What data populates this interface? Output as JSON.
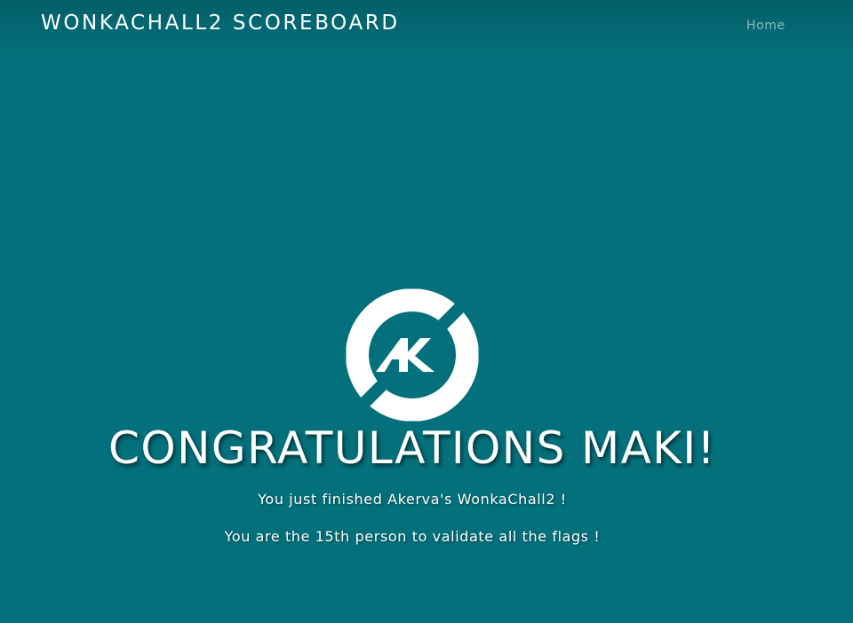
{
  "navbar": {
    "brand": "WONKACHALL2 SCOREBOARD",
    "home_link": "Home"
  },
  "logo": {
    "name": "akerva-logo",
    "letters": "AK"
  },
  "main": {
    "headline": "CONGRATULATIONS MAKI!",
    "line1": "You just finished Akerva's WonkaChall2 !",
    "line2": "You are the 15th person to validate all the flags !"
  },
  "colors": {
    "background": "#03707b",
    "navbar_top": "#025f68",
    "text": "#ffffff",
    "nav_link": "rgba(255,255,255,0.55)"
  }
}
